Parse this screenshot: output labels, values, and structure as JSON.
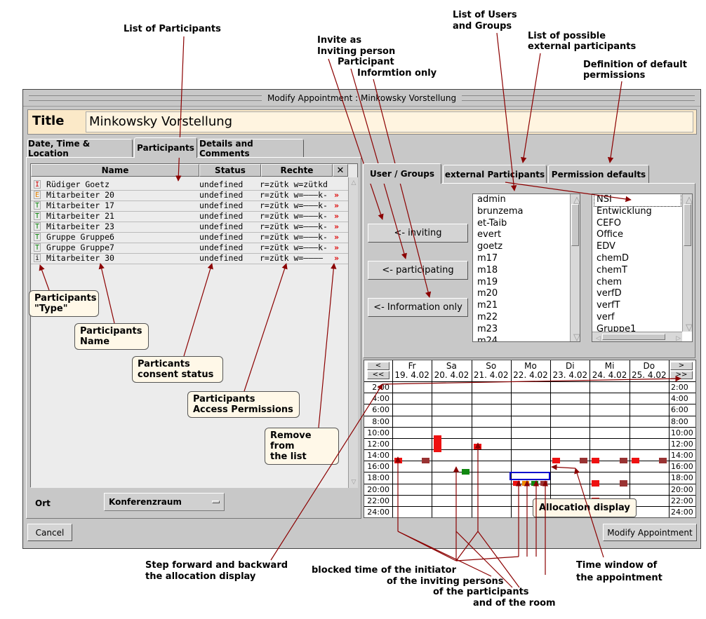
{
  "annotations": {
    "list_participants": "List of Participants",
    "invite_as": "Invite as",
    "inviting_person": "Inviting person",
    "participant": "Participant",
    "information_only": "Informtion only",
    "list_users_l1": "List of Users",
    "list_users_l2": "and Groups",
    "list_external_l1": "List of possible",
    "list_external_l2": "external participants",
    "def_perm_l1": "Definition of default",
    "def_perm_l2": "permissions",
    "type_l1": "Participants",
    "type_l2": "\"Type\"",
    "name_l1": "Participants",
    "name_l2": "Name",
    "consent_l1": "Particants",
    "consent_l2": "consent status",
    "access_l1": "Participants",
    "access_l2": "Access Permissions",
    "remove_l1": "Remove from",
    "remove_l2": "the list",
    "allocation": "Allocation display",
    "step_l1": "Step forward and backward",
    "step_l2": "the allocation display",
    "blocked_l1": "blocked time of the initiator",
    "blocked_l2": "of the inviting persons",
    "blocked_l3": "of the participants",
    "blocked_l4": "and of the room",
    "timewin_l1": "Time window of",
    "timewin_l2": "the appointment"
  },
  "window": {
    "title": "Modify Appointment : Minkowsky Vorstellung",
    "title_label": "Title",
    "title_value": "Minkowsky Vorstellung"
  },
  "left_tabs": [
    "Date, Time & Location",
    "Participants",
    "Details and Comments"
  ],
  "table": {
    "headers": {
      "name": "Name",
      "status": "Status",
      "rechte": "Rechte",
      "remove": "✕"
    },
    "rows": [
      {
        "type": "I",
        "type_color": "#cc0000",
        "name": "Rüdiger Goetz",
        "status": "undefined",
        "rights": "r=zütk w=zütkd",
        "remove": ""
      },
      {
        "type": "E",
        "type_color": "#e08000",
        "name": "Mitarbeiter 20",
        "status": "undefined",
        "rights": "r=zütk w=———k-",
        "remove": "»"
      },
      {
        "type": "T",
        "type_color": "#008000",
        "name": "Mitarbeiter 17",
        "status": "undefined",
        "rights": "r=zütk w=———k-",
        "remove": "»"
      },
      {
        "type": "T",
        "type_color": "#008000",
        "name": "Mitarbeiter 21",
        "status": "undefined",
        "rights": "r=zütk w=———k-",
        "remove": "»"
      },
      {
        "type": "T",
        "type_color": "#008000",
        "name": "Mitarbeiter 23",
        "status": "undefined",
        "rights": "r=zütk w=———k-",
        "remove": "»"
      },
      {
        "type": "T",
        "type_color": "#008000",
        "name": "Gruppe Gruppe6",
        "status": "undefined",
        "rights": "r=zütk w=———k-",
        "remove": "»"
      },
      {
        "type": "T",
        "type_color": "#008000",
        "name": "Gruppe Gruppe7",
        "status": "undefined",
        "rights": "r=zütk w=———k-",
        "remove": "»"
      },
      {
        "type": "i",
        "type_color": "#000000",
        "name": "Mitarbeiter 30",
        "status": "undefined",
        "rights": "r=zütk w=————",
        "remove": "»"
      }
    ]
  },
  "ort": {
    "label": "Ort",
    "value": "Konferenzraum"
  },
  "right_tabs": [
    "User / Groups",
    "external Participants",
    "Permission defaults"
  ],
  "invite_buttons": [
    "<- inviting",
    "<- participating",
    "<- Information only"
  ],
  "users": [
    "admin",
    "brunzema",
    "et-Taib",
    "evert",
    "goetz",
    "m17",
    "m18",
    "m19",
    "m20",
    "m21",
    "m22",
    "m23",
    "m24"
  ],
  "groups": [
    "NSI",
    "Entwicklung",
    "CEFO",
    "Office",
    "EDV",
    "chemD",
    "chemT",
    "chem",
    "verfD",
    "verfT",
    "verf",
    "Gruppe1"
  ],
  "calendar": {
    "nav_left": [
      "<",
      "<<"
    ],
    "nav_right": [
      ">",
      ">>"
    ],
    "days": [
      {
        "name": "Fr",
        "date": "19. 4.02"
      },
      {
        "name": "Sa",
        "date": "20. 4.02"
      },
      {
        "name": "So",
        "date": "21. 4.02"
      },
      {
        "name": "Mo",
        "date": "22. 4.02"
      },
      {
        "name": "Di",
        "date": "23. 4.02"
      },
      {
        "name": "Mi",
        "date": "24. 4.02"
      },
      {
        "name": "Do",
        "date": "25. 4.02"
      }
    ],
    "times": [
      "2:00",
      "4:00",
      "6:00",
      "8:00",
      "10:00",
      "12:00",
      "14:00",
      "16:00",
      "18:00",
      "20:00",
      "22:00",
      "24:00"
    ],
    "colors": {
      "initiator": "#ee1111",
      "participant": "#993333",
      "inviting": "#ee8800",
      "room": "#118811",
      "window": "#0000cc"
    },
    "blocks": [
      {
        "day": 0,
        "start": 13.5,
        "end": 14.5,
        "col": 0,
        "cols": 2,
        "kind": "initiator"
      },
      {
        "day": 0,
        "start": 13.5,
        "end": 14.5,
        "col": 1,
        "cols": 1,
        "kind": "participant",
        "offset": "right"
      },
      {
        "day": 1,
        "start": 9.5,
        "end": 12.5,
        "col": 0,
        "cols": 1,
        "kind": "initiator"
      },
      {
        "day": 2,
        "start": 11,
        "end": 12,
        "col": 0,
        "cols": 1,
        "kind": "initiator"
      },
      {
        "day": 1,
        "start": 15.5,
        "end": 16.5,
        "col": 1,
        "cols": 1,
        "kind": "room"
      },
      {
        "day": 4,
        "start": 13.5,
        "end": 14.5,
        "col": 0,
        "cols": 1,
        "kind": "initiator"
      },
      {
        "day": 4,
        "start": 13.5,
        "end": 14.5,
        "col": 1,
        "cols": 1,
        "kind": "participant"
      },
      {
        "day": 5,
        "start": 13.5,
        "end": 14.5,
        "col": 0,
        "cols": 1,
        "kind": "initiator"
      },
      {
        "day": 5,
        "start": 13.5,
        "end": 14.5,
        "col": 1,
        "cols": 1,
        "kind": "participant"
      },
      {
        "day": 6,
        "start": 13.5,
        "end": 14.5,
        "col": 0,
        "cols": 1,
        "kind": "initiator"
      },
      {
        "day": 6,
        "start": 13.5,
        "end": 14.5,
        "col": 1,
        "cols": 1,
        "kind": "participant"
      },
      {
        "day": 5,
        "start": 17.5,
        "end": 18.5,
        "col": 0,
        "cols": 1,
        "kind": "initiator"
      },
      {
        "day": 5,
        "start": 17.5,
        "end": 18.5,
        "col": 1,
        "cols": 1,
        "kind": "participant"
      },
      {
        "day": 5,
        "start": 20.5,
        "end": 23.5,
        "col": 0,
        "cols": 1,
        "kind": "initiator"
      }
    ],
    "window_block": {
      "day": 3,
      "start": 16,
      "end": 17.5
    }
  },
  "buttons": {
    "cancel": "Cancel",
    "modify": "Modify Appointment"
  }
}
